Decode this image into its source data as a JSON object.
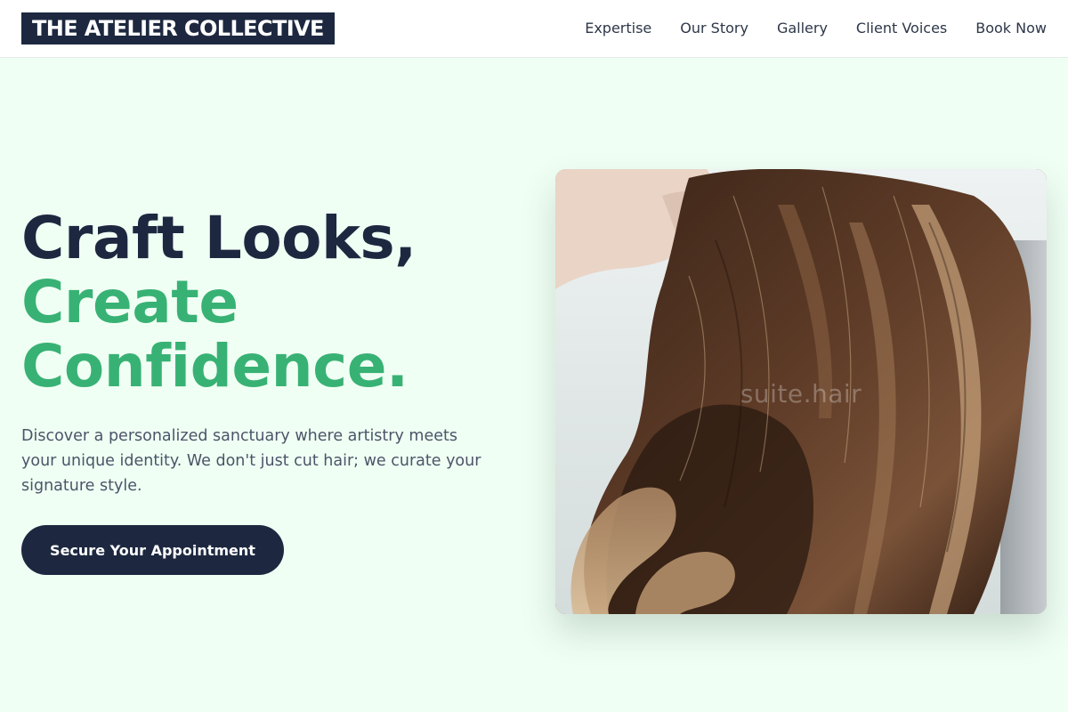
{
  "brand": {
    "name": "THE ATELIER COLLECTIVE"
  },
  "nav": {
    "items": [
      {
        "label": "Expertise"
      },
      {
        "label": "Our Story"
      },
      {
        "label": "Gallery"
      },
      {
        "label": "Client Voices"
      },
      {
        "label": "Book Now"
      }
    ]
  },
  "hero": {
    "headline_line1": "Craft Looks,",
    "headline_line2": "Create",
    "headline_line3": "Confidence.",
    "description": "Discover a personalized sanctuary where artistry meets your unique identity. We don't just cut hair; we curate your signature style.",
    "cta_label": "Secure Your Appointment",
    "image_watermark": "suite.hair"
  },
  "colors": {
    "page_background": "#f0fff4",
    "navy": "#1d2840",
    "accent_green": "#38b274",
    "body_text": "#4a5568"
  }
}
